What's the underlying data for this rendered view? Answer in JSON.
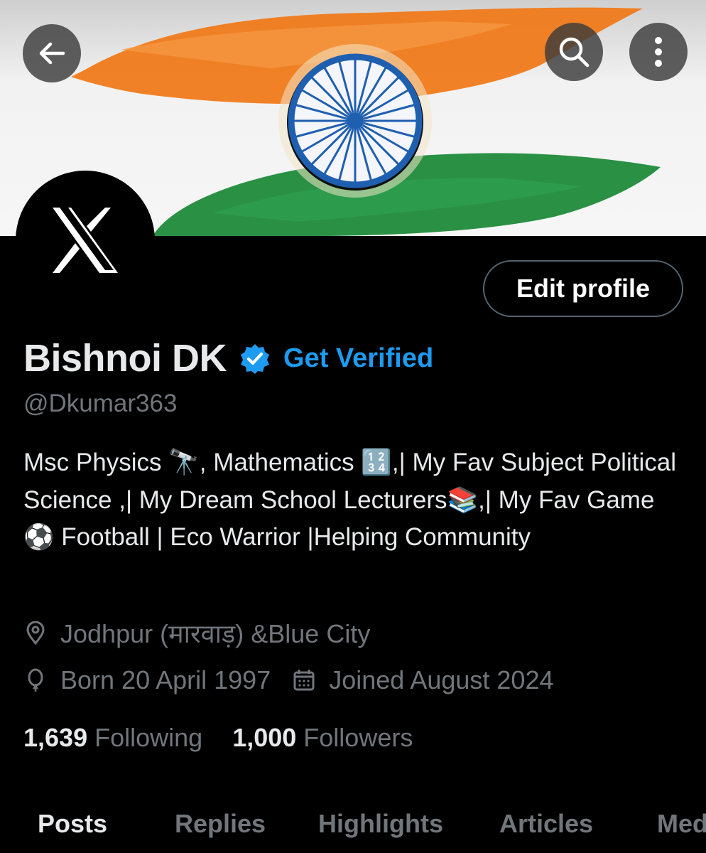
{
  "header": {
    "back_icon": "arrow-left-icon",
    "search_icon": "search-icon",
    "more_icon": "more-vertical-icon"
  },
  "banner": {
    "colors": {
      "saffron": "#f07a1a",
      "white": "#f3f3f3",
      "green": "#1f8a3a",
      "chakra": "#1f5fb0"
    }
  },
  "profile": {
    "avatar_icon": "x-logo-icon",
    "edit_button": "Edit profile",
    "name": "Bishnoi DK",
    "verified_icon": "verified-badge-icon",
    "get_verified": "Get Verified",
    "handle": "@Dkumar363",
    "bio": "Msc Physics 🔭, Mathematics 🔢,| My Fav Subject Political Science ,| My Dream School Lecturers📚,| My Fav Game ⚽ Football | Eco Warrior |Helping Community",
    "location": "Jodhpur (मारवाड़) &Blue City",
    "born": "Born 20 April 1997",
    "joined": "Joined August 2024",
    "following_count": "1,639",
    "following_label": "Following",
    "followers_count": "1,000",
    "followers_label": "Followers"
  },
  "tabs": [
    {
      "label": "Posts",
      "active": true
    },
    {
      "label": "Replies",
      "active": false
    },
    {
      "label": "Highlights",
      "active": false
    },
    {
      "label": "Articles",
      "active": false
    },
    {
      "label": "Media",
      "active": false
    }
  ],
  "colors": {
    "background": "#000000",
    "text_primary": "#e7e9ea",
    "text_secondary": "#71767b",
    "accent": "#1d9bf0",
    "border": "#536471"
  }
}
